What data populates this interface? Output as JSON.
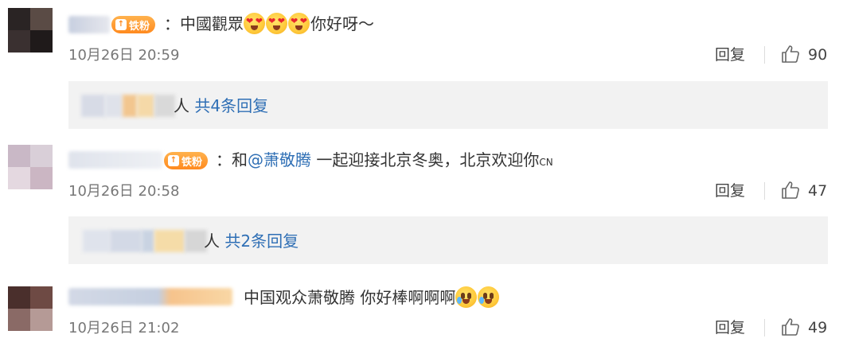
{
  "comments": [
    {
      "badge_label": "铁粉",
      "text_prefix": "：中國觀眾",
      "text_suffix": "你好呀～",
      "emojis": [
        "heart-eyes-emoji",
        "heart-eyes-emoji",
        "heart-eyes-emoji"
      ],
      "time": "10月26日 20:59",
      "reply_label": "回复",
      "likes": "90",
      "thread": {
        "people_label": "人",
        "link_label": "共4条回复"
      }
    },
    {
      "badge_label": "铁粉",
      "text_prefix": "：和",
      "mention": "@萧敬腾",
      "text_suffix": " 一起迎接北京冬奥，北京欢迎你",
      "flag": "CN",
      "time": "10月26日 20:58",
      "reply_label": "回复",
      "likes": "47",
      "thread": {
        "people_label": "人",
        "link_label": "共2条回复"
      }
    },
    {
      "text_prefix": "中国观众萧敬腾 你好棒啊啊啊",
      "emojis": [
        "crying-face-emoji",
        "crying-face-emoji"
      ],
      "time": "10月26日 21:02",
      "reply_label": "回复",
      "likes": "49"
    }
  ]
}
